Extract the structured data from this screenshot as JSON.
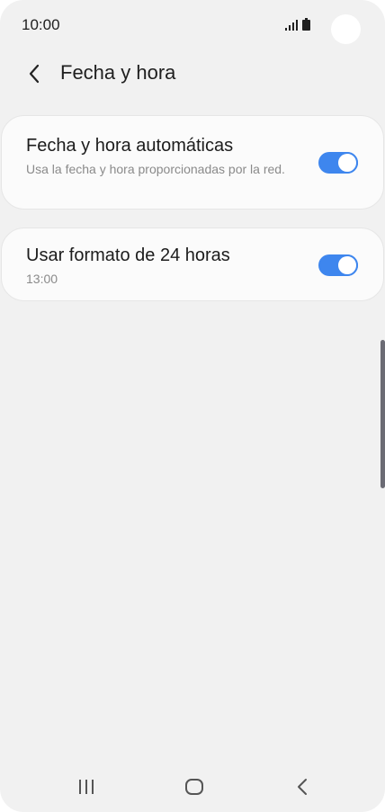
{
  "status_bar": {
    "time": "10:00",
    "icons": [
      "signal-icon",
      "battery-icon"
    ]
  },
  "header": {
    "title": "Fecha y hora",
    "back_icon": "chevron-left-icon"
  },
  "settings": [
    {
      "title": "Fecha y hora automáticas",
      "subtitle": "Usa la fecha y hora proporcionadas por la red.",
      "enabled": true
    },
    {
      "title": "Usar formato de 24 horas",
      "subtitle": "13:00",
      "enabled": true
    }
  ],
  "nav_bar": {
    "icons": [
      "recent-apps-icon",
      "home-icon",
      "back-icon"
    ]
  },
  "colors": {
    "accent": "#3e86ee",
    "background": "#f1f1f1",
    "card": "#fbfbfb"
  }
}
